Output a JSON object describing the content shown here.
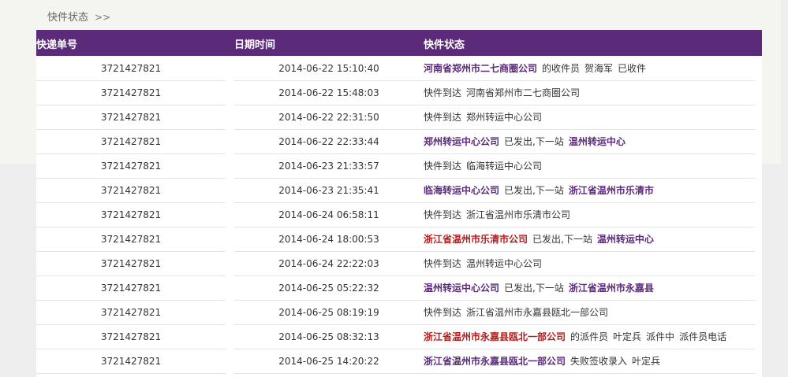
{
  "breadcrumb": {
    "title": "快件状态",
    "separator": ">>"
  },
  "table": {
    "headers": {
      "number": "快递单号",
      "datetime": "日期时间",
      "status": "快件状态"
    },
    "rows": [
      {
        "number": "3721427821",
        "datetime": "2014-06-22 15:10:40",
        "status": [
          {
            "text": "河南省郑州市二七商圈公司",
            "style": "p"
          },
          {
            "text": "的收件员",
            "style": "n"
          },
          {
            "text": "贺海军",
            "style": "n"
          },
          {
            "text": "已收件",
            "style": "n"
          }
        ]
      },
      {
        "number": "3721427821",
        "datetime": "2014-06-22 15:48:03",
        "status": [
          {
            "text": "快件到达",
            "style": "n"
          },
          {
            "text": "河南省郑州市二七商圈公司",
            "style": "n"
          }
        ]
      },
      {
        "number": "3721427821",
        "datetime": "2014-06-22 22:31:50",
        "status": [
          {
            "text": "快件到达",
            "style": "n"
          },
          {
            "text": "郑州转运中心公司",
            "style": "n"
          }
        ]
      },
      {
        "number": "3721427821",
        "datetime": "2014-06-22 22:33:44",
        "status": [
          {
            "text": "郑州转运中心公司",
            "style": "p"
          },
          {
            "text": "已发出,下一站",
            "style": "n"
          },
          {
            "text": "温州转运中心",
            "style": "p"
          }
        ]
      },
      {
        "number": "3721427821",
        "datetime": "2014-06-23 21:33:57",
        "status": [
          {
            "text": "快件到达",
            "style": "n"
          },
          {
            "text": "临海转运中心公司",
            "style": "n"
          }
        ]
      },
      {
        "number": "3721427821",
        "datetime": "2014-06-23 21:35:41",
        "status": [
          {
            "text": "临海转运中心公司",
            "style": "p"
          },
          {
            "text": "已发出,下一站",
            "style": "n"
          },
          {
            "text": "浙江省温州市乐清市",
            "style": "p"
          }
        ]
      },
      {
        "number": "3721427821",
        "datetime": "2014-06-24 06:58:11",
        "status": [
          {
            "text": "快件到达",
            "style": "n"
          },
          {
            "text": "浙江省温州市乐清市公司",
            "style": "n"
          }
        ]
      },
      {
        "number": "3721427821",
        "datetime": "2014-06-24 18:00:53",
        "status": [
          {
            "text": "浙江省温州市乐清市公司",
            "style": "r"
          },
          {
            "text": "已发出,下一站",
            "style": "n"
          },
          {
            "text": "温州转运中心",
            "style": "p"
          }
        ]
      },
      {
        "number": "3721427821",
        "datetime": "2014-06-24 22:22:03",
        "status": [
          {
            "text": "快件到达",
            "style": "n"
          },
          {
            "text": "温州转运中心公司",
            "style": "n"
          }
        ]
      },
      {
        "number": "3721427821",
        "datetime": "2014-06-25 05:22:32",
        "status": [
          {
            "text": "温州转运中心公司",
            "style": "p"
          },
          {
            "text": "已发出,下一站",
            "style": "n"
          },
          {
            "text": "浙江省温州市永嘉县",
            "style": "p"
          }
        ]
      },
      {
        "number": "3721427821",
        "datetime": "2014-06-25 08:19:19",
        "status": [
          {
            "text": "快件到达",
            "style": "n"
          },
          {
            "text": "浙江省温州市永嘉县瓯北一部公司",
            "style": "n"
          }
        ]
      },
      {
        "number": "3721427821",
        "datetime": "2014-06-25 08:32:13",
        "status": [
          {
            "text": "浙江省温州市永嘉县瓯北一部公司",
            "style": "r"
          },
          {
            "text": "的派件员",
            "style": "n"
          },
          {
            "text": "叶定兵",
            "style": "n"
          },
          {
            "text": "派件中",
            "style": "n"
          },
          {
            "text": "派件员电话",
            "style": "n"
          }
        ]
      },
      {
        "number": "3721427821",
        "datetime": "2014-06-25 14:20:22",
        "status": [
          {
            "text": "浙江省温州市永嘉县瓯北一部公司",
            "style": "p"
          },
          {
            "text": "失败签收录入",
            "style": "n"
          },
          {
            "text": "叶定兵",
            "style": "n"
          }
        ]
      }
    ]
  }
}
